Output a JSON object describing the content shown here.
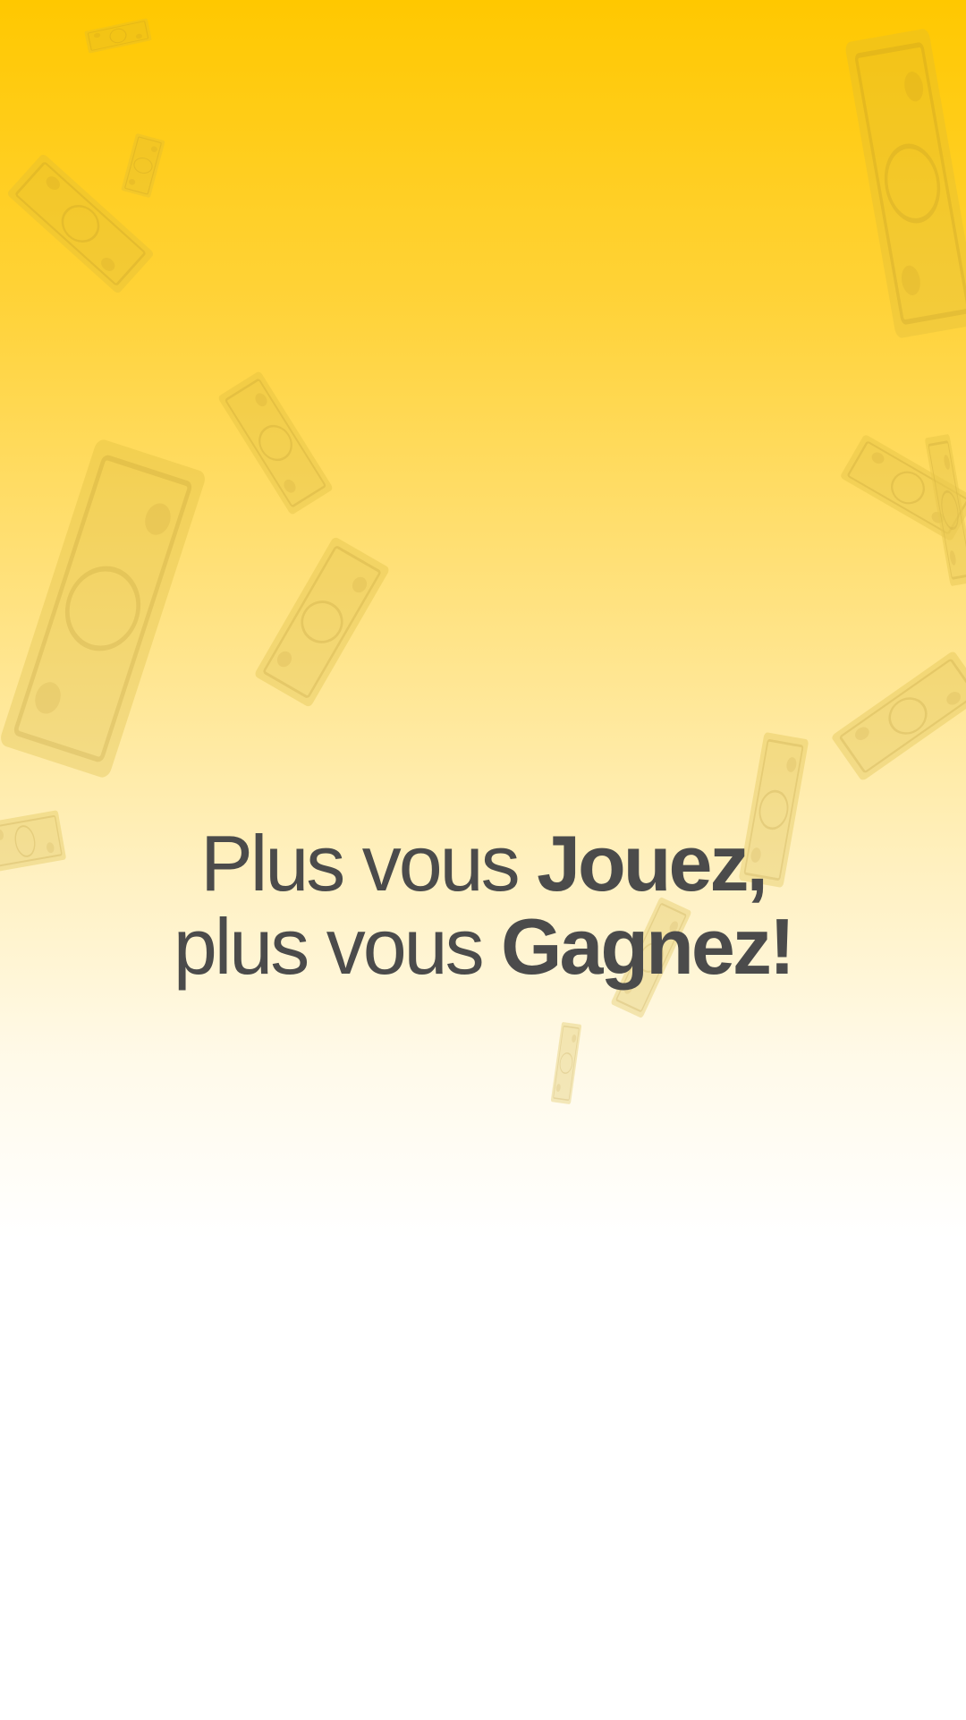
{
  "splash": {
    "headline": {
      "line1_regular": "Plus vous ",
      "line1_bold": "Jouez,",
      "line2_regular": "plus vous ",
      "line2_bold": "Gagnez!"
    }
  },
  "colors": {
    "gradient_top": "#FFC800",
    "gradient_mid": "#FFE89A",
    "gradient_bottom": "#FFFFFF",
    "text": "#4B4B4B",
    "bill": "#D9B83A"
  },
  "background": {
    "decoration": "falling-dollar-bills"
  }
}
